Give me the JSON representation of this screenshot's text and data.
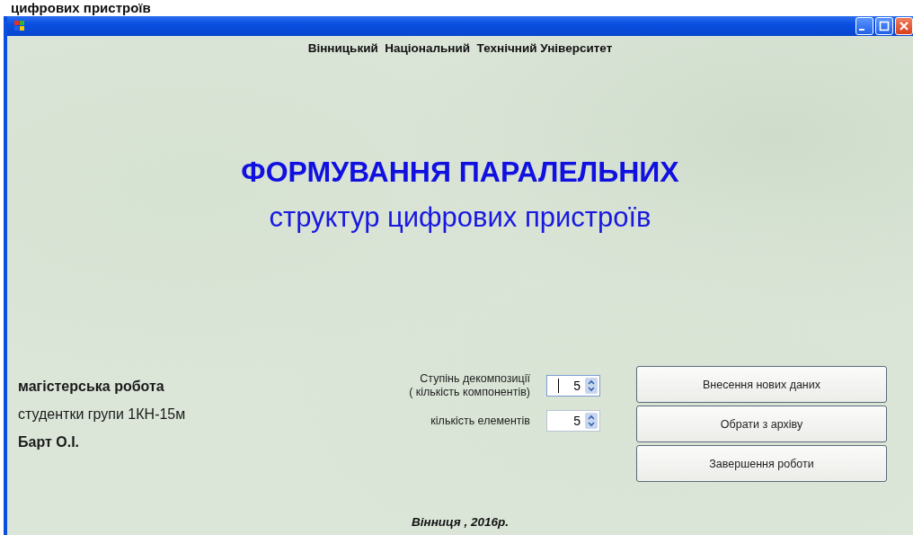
{
  "page_heading": "цифрових пристроїв",
  "window": {
    "title_buttons": [
      {
        "kind": "minimize"
      },
      {
        "kind": "maximize"
      },
      {
        "kind": "close"
      }
    ]
  },
  "university": "Вінницький  Національний  Технічний Університет",
  "title": "ФОРМУВАННЯ ПАРАЛЕЛЬНИХ",
  "subtitle": "структур цифрових пристроїв",
  "author": [
    {
      "text": "магістерська робота",
      "bold": true
    },
    {
      "text": "студентки групи 1КН-15м",
      "bold": false
    },
    {
      "text": "Барт О.І.",
      "bold": true
    }
  ],
  "spin_fields": [
    {
      "label": "Ступінь декомпозиції\n ( кількість компонентів)",
      "value": "5",
      "focused": true
    },
    {
      "label": "кількість елементів",
      "value": "5",
      "focused": false
    }
  ],
  "buttons": [
    "Внесення нових даних",
    "Обрати з архіву",
    "Завершення роботи"
  ],
  "footer": "Вінниця , 2016р."
}
